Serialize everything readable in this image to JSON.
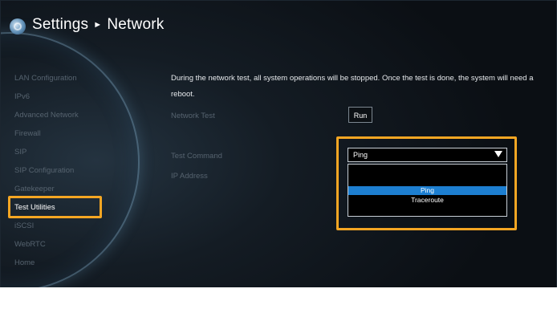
{
  "header": {
    "section": "Settings",
    "separator": "►",
    "page": "Network"
  },
  "sidebar": {
    "items": [
      {
        "label": "LAN Configuration",
        "active": false
      },
      {
        "label": "IPv6",
        "active": false
      },
      {
        "label": "Advanced Network",
        "active": false
      },
      {
        "label": "Firewall",
        "active": false
      },
      {
        "label": "SIP",
        "active": false
      },
      {
        "label": "SIP Configuration",
        "active": false
      },
      {
        "label": "Gatekeeper",
        "active": false
      },
      {
        "label": "Test Utilities",
        "active": true
      },
      {
        "label": "iSCSI",
        "active": false
      },
      {
        "label": "WebRTC",
        "active": false
      },
      {
        "label": "Home",
        "active": false
      }
    ]
  },
  "main": {
    "notice": "During the network test, all system operations will be stopped. Once the test is done, the system will need a reboot.",
    "network_test_label": "Network Test",
    "run_label": "Run",
    "test_command_label": "Test Command",
    "ip_address_label": "IP Address",
    "test_command": {
      "selected": "Ping",
      "options": [
        "Ping",
        "Traceroute"
      ],
      "highlighted_option": "Ping"
    }
  },
  "colors": {
    "highlight": "#f5a623",
    "selected_option": "#1d7fd1",
    "inactive_text": "#56636f",
    "background": "#0b0f14"
  }
}
